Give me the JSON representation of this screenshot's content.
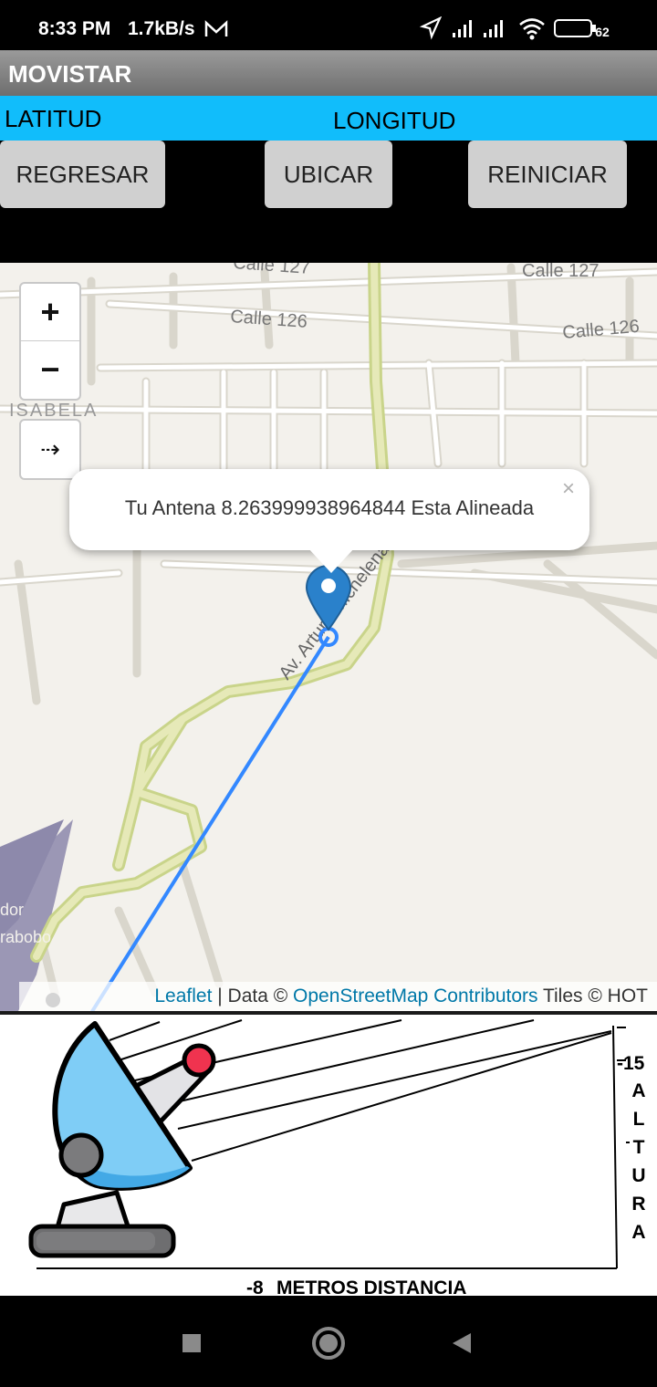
{
  "status_bar": {
    "time": "8:33 PM",
    "speed": "1.7kB/s",
    "battery": "62"
  },
  "app_bar": {
    "title": "MOVISTAR"
  },
  "coords": {
    "lat_label": "LATITUD",
    "lon_label": "LONGITUD"
  },
  "buttons": {
    "back": "REGRESAR",
    "locate": "UBICAR",
    "reset": "REINICIAR"
  },
  "map": {
    "zoom_in": "+",
    "zoom_out": "−",
    "arrow": "⇢",
    "street_labels": [
      "Calle 127",
      "Calle 127",
      "Calle 126",
      "Calle 126",
      "ISABELA",
      "Av. Arturo Michelena",
      "dor",
      "rabobo"
    ],
    "popup": {
      "text": "Tu Antena 8.263999938964844 Esta Alineada",
      "close": "×"
    },
    "attribution": {
      "leaflet": "Leaflet",
      "sep": " | Data © ",
      "osm": "OpenStreetMap Contributors",
      "tiles": " Tiles © HOT"
    },
    "line_color": "#3388ff",
    "marker_color": "#2a81cb"
  },
  "dish_panel": {
    "altura_value": "-15",
    "altura_letters": [
      "A",
      "L",
      "T",
      "U",
      "R",
      "A"
    ],
    "distance_value": "-8",
    "distance_label": "METROS DISTANCIA"
  }
}
